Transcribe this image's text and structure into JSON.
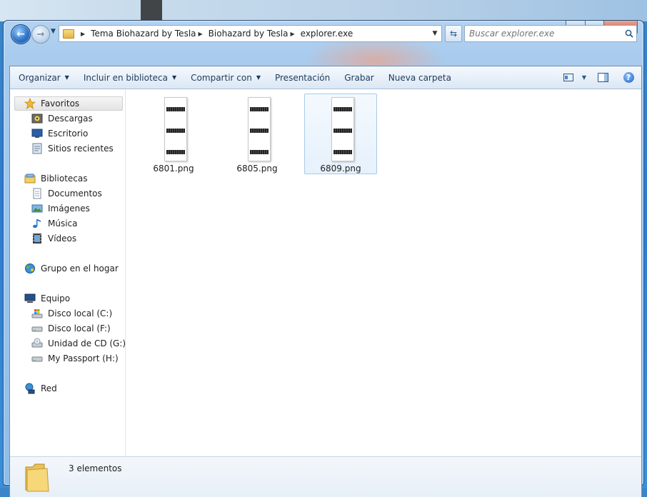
{
  "address": {
    "crumbs": [
      "Tema Biohazard by Tesla",
      "Biohazard by Tesla",
      "explorer.exe"
    ]
  },
  "search": {
    "placeholder": "Buscar explorer.exe"
  },
  "toolbar": {
    "organize": "Organizar",
    "include_library": "Incluir en biblioteca",
    "share_with": "Compartir con",
    "presentation": "Presentación",
    "burn": "Grabar",
    "new_folder": "Nueva carpeta"
  },
  "navigation": {
    "favorites": {
      "label": "Favoritos",
      "items": [
        "Descargas",
        "Escritorio",
        "Sitios recientes"
      ]
    },
    "libraries": {
      "label": "Bibliotecas",
      "items": [
        "Documentos",
        "Imágenes",
        "Música",
        "Vídeos"
      ]
    },
    "homegroup": {
      "label": "Grupo en el hogar"
    },
    "computer": {
      "label": "Equipo",
      "items": [
        "Disco local (C:)",
        "Disco local (F:)",
        "Unidad de CD (G:)",
        "My Passport (H:)"
      ]
    },
    "network": {
      "label": "Red"
    }
  },
  "files": [
    {
      "name": "6801.png",
      "selected": false
    },
    {
      "name": "6805.png",
      "selected": false
    },
    {
      "name": "6809.png",
      "selected": true
    }
  ],
  "details": {
    "count": "3 elementos"
  },
  "colors": {
    "accent": "#2f7bd0",
    "selection": "#e6f1fc",
    "selection_border": "#a8cbea"
  }
}
